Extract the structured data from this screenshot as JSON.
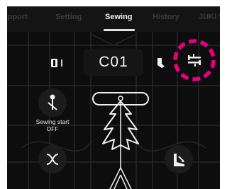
{
  "tabs": [
    {
      "label": "Support",
      "shown": "upport",
      "active": false
    },
    {
      "label": "Setting",
      "active": false
    },
    {
      "label": "Sewing",
      "active": true
    },
    {
      "label": "History",
      "active": false
    },
    {
      "label": "JUKI S",
      "active": false
    }
  ],
  "pattern": {
    "code": "C01"
  },
  "controls": {
    "sewing_start_label": "Sewing start",
    "sewing_start_value": "OFF"
  },
  "highlight_color": "#e6007e",
  "icons": [
    "bobbin-icon",
    "foot-icon",
    "swap-icon",
    "needle-icon",
    "curve-stitch-icon",
    "presser-foot-icon"
  ]
}
